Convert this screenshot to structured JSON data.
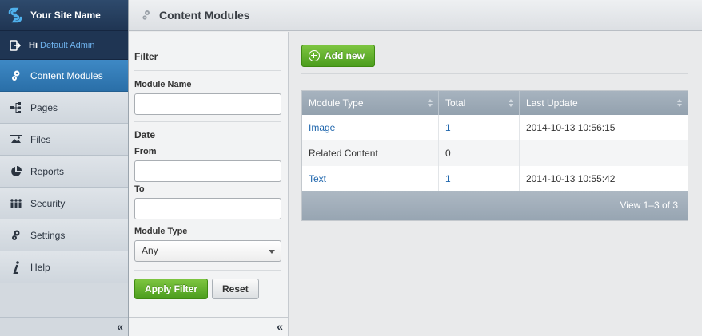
{
  "brand": {
    "name": "Your Site Name"
  },
  "user": {
    "greeting": "Hi",
    "name": "Default Admin"
  },
  "sidebar": {
    "items": [
      {
        "label": "Content Modules",
        "icon": "gears-icon"
      },
      {
        "label": "Pages",
        "icon": "sitemap-icon"
      },
      {
        "label": "Files",
        "icon": "image-icon"
      },
      {
        "label": "Reports",
        "icon": "pie-chart-icon"
      },
      {
        "label": "Security",
        "icon": "users-icon"
      },
      {
        "label": "Settings",
        "icon": "gears-icon"
      },
      {
        "label": "Help",
        "icon": "info-icon"
      }
    ],
    "collapse": "«"
  },
  "header": {
    "title": "Content Modules"
  },
  "filter": {
    "title": "Filter",
    "module_name_label": "Module Name",
    "module_name_value": "",
    "date_label": "Date",
    "from_label": "From",
    "to_label": "To",
    "module_type_label": "Module Type",
    "module_type_value": "Any",
    "apply_label": "Apply Filter",
    "reset_label": "Reset",
    "collapse": "«"
  },
  "main": {
    "add_label": "Add new",
    "columns": [
      "Module Type",
      "Total",
      "Last Update"
    ],
    "rows": [
      {
        "type": "Image",
        "total": "1",
        "updated": "2014-10-13 10:56:15",
        "link": true
      },
      {
        "type": "Related Content",
        "total": "0",
        "updated": "",
        "link": false
      },
      {
        "type": "Text",
        "total": "1",
        "updated": "2014-10-13 10:55:42",
        "link": true
      }
    ],
    "pager": "View 1–3 of 3"
  },
  "colors": {
    "accent_blue": "#2a6fa8",
    "green": "#5aad28",
    "link": "#1f66ad"
  }
}
